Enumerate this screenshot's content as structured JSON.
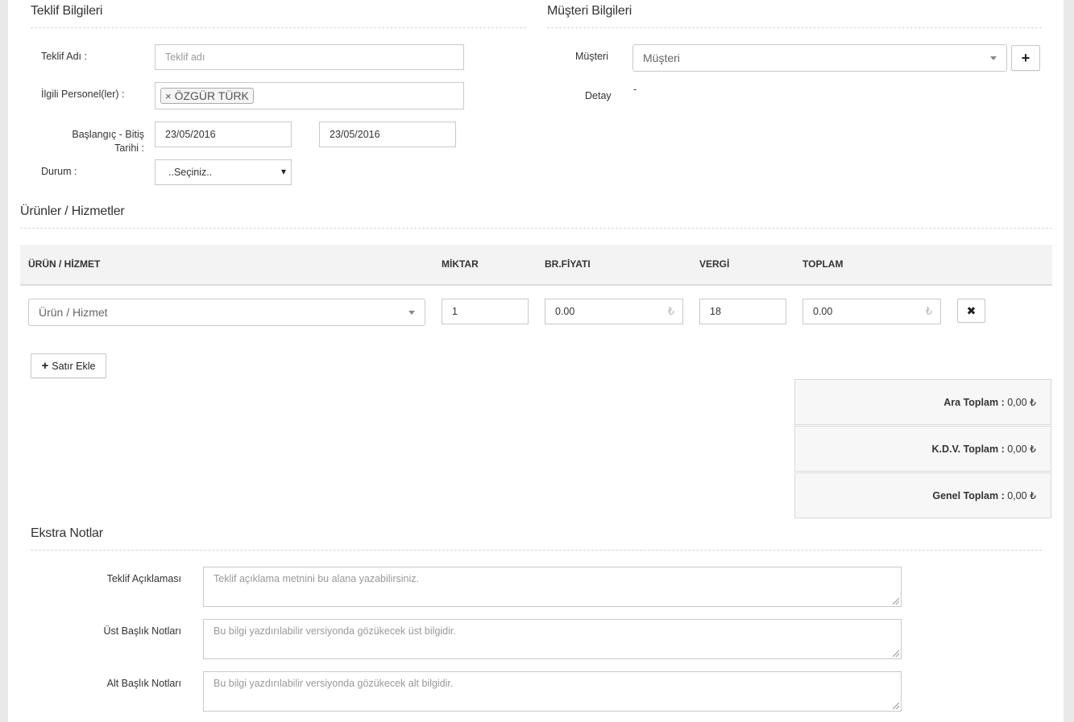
{
  "offer_info": {
    "title": "Teklif Bilgileri",
    "name_label": "Teklif Adı :",
    "name_placeholder": "Teklif adı",
    "staff_label": "İlgili Personel(ler) :",
    "staff_tag": "ÖZGÜR TÜRK",
    "tag_remove": "×",
    "date_label_line1": "Başlangıç - Bitiş",
    "date_label_line2": "Tarihi :",
    "start_date": "23/05/2016",
    "end_date": "23/05/2016",
    "status_label": "Durum :",
    "status_value": "..Seçiniz..",
    "status_caret": "▾"
  },
  "customer_info": {
    "title": "Müşteri Bilgileri",
    "customer_label": "Müşteri",
    "customer_placeholder": "Müşteri",
    "add_glyph": "+",
    "detail_label": "Detay",
    "detail_value": "-"
  },
  "products": {
    "title": "Ürünler / Hizmetler",
    "columns": [
      "ÜRÜN / HİZMET",
      "MİKTAR",
      "BR.FİYATI",
      "VERGİ",
      "TOPLAM"
    ],
    "row": {
      "product_placeholder": "Ürün / Hizmet",
      "quantity": "1",
      "unit_price": "0.00",
      "tax": "18",
      "total": "0.00",
      "currency_symbol": "₺",
      "remove_glyph": "✖"
    },
    "add_row_label": "Satır Ekle",
    "add_row_glyph": "+"
  },
  "totals": {
    "subtotal_label": "Ara Toplam :",
    "subtotal_value": "0,00 ₺",
    "vat_label": "K.D.V. Toplam :",
    "vat_value": "0,00 ₺",
    "grand_label": "Genel Toplam :",
    "grand_value": "0,00 ₺"
  },
  "notes": {
    "title": "Ekstra Notlar",
    "description_label": "Teklif Açıklaması",
    "description_placeholder": "Teklif açıklama metnini bu alana yazabilirsiniz.",
    "header_label": "Üst Başlık Notları",
    "header_placeholder": "Bu bilgi yazdırılabilir versiyonda gözükecek üst bilgidir.",
    "footer_label": "Alt Başlık Notları",
    "footer_placeholder": "Bu bilgi yazdırılabilir versiyonda gözükecek alt bilgidir."
  }
}
